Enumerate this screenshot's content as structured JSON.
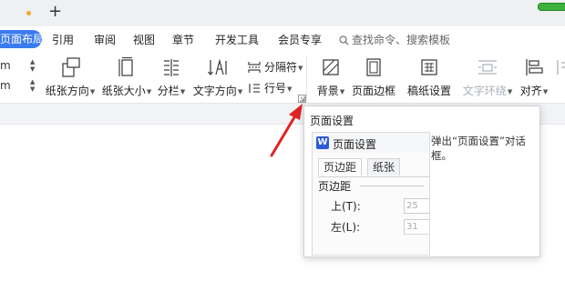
{
  "menubar": {
    "active": "页面布局",
    "items": [
      "引用",
      "审阅",
      "视图",
      "章节",
      "开发工具",
      "会员专享"
    ],
    "search_placeholder": "查找命令、搜索模板"
  },
  "ribbon": {
    "spinners": [
      {
        "value": "m"
      },
      {
        "value": "m"
      }
    ],
    "tools": {
      "orientation": "纸张方向",
      "size": "纸张大小",
      "columns": "分栏",
      "text_direction": "文字方向",
      "separator": "分隔符",
      "line_number": "行号",
      "background": "背景",
      "page_border": "页面边框",
      "manuscript": "稿纸设置",
      "text_wrap": "文字环绕",
      "align": "对齐"
    }
  },
  "tooltip": {
    "title": "页面设置",
    "description": "弹出“页面设置”对话框。",
    "preview": {
      "dialog_title": "页面设置",
      "tabs": [
        "页边距",
        "纸张"
      ],
      "section": "页边距",
      "fields": [
        {
          "label": "上(T):",
          "value": "25"
        },
        {
          "label": "左(L):",
          "value": "31"
        }
      ]
    }
  },
  "colors": {
    "accent": "#3a7cf0",
    "arrow": "#e02424",
    "tab_dot": "#f5a623",
    "status_green": "#3db13d"
  }
}
